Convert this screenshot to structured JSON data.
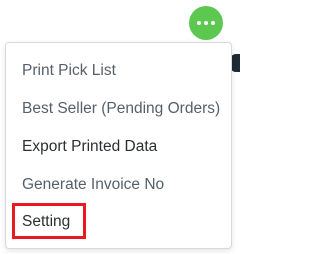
{
  "header": {
    "more_icon": "ellipsis-horizontal-icon",
    "accent_color": "#5cc84f"
  },
  "menu": {
    "items": [
      {
        "label": "Print Pick List"
      },
      {
        "label": "Best Seller (Pending Orders)"
      },
      {
        "label": "Export Printed Data"
      },
      {
        "label": "Generate Invoice No"
      },
      {
        "label": "Setting"
      }
    ],
    "highlight_color": "#e8191f"
  }
}
